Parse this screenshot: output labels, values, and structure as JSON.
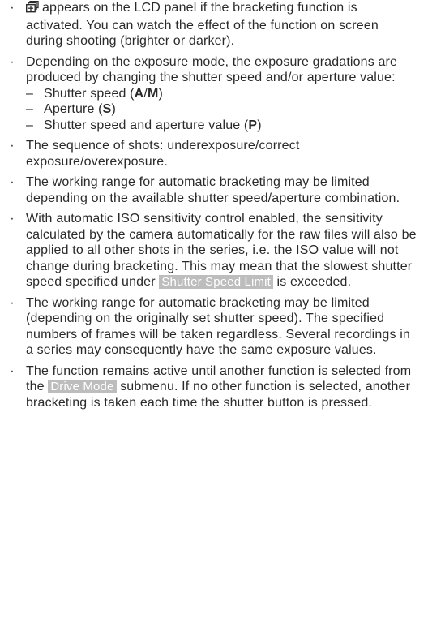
{
  "bullets": [
    {
      "icon": "bracketing-icon",
      "text": "appears on the LCD panel if the bracketing function is activated. You can watch the effect of the function on screen during shooting (brighter or darker)."
    },
    {
      "text": "Depending on the exposure mode, the exposure gradations are produced by changing the shutter speed and/or aperture value:",
      "sub": [
        {
          "pre": "Shutter speed (",
          "b1": "A",
          "mid": "/",
          "b2": "M",
          "post": ")"
        },
        {
          "pre": "Aperture (",
          "b1": "S",
          "post": ")"
        },
        {
          "pre": "Shutter speed and aperture value (",
          "b1": "P",
          "post": ")"
        }
      ]
    },
    {
      "text": "The sequence of shots: underexposure/correct exposure/overexposure."
    },
    {
      "text": "The working range for automatic bracketing may be limited depending on the available shutter speed/aperture combination."
    },
    {
      "pre": "With automatic ISO sensitivity control enabled, the sensitivity calculated by the camera automatically for the raw files will also be applied to all other shots in the series, i.e. the ISO value will not change during bracketing. This may mean that the slowest shutter speed specified under",
      "menu": "Shutter Speed Limit",
      "post": "is exceeded."
    },
    {
      "text": "The working range for automatic bracketing may be limited (depending on the originally set shutter speed). The specified numbers of frames will be taken regardless. Several recordings in a series may consequently have the same exposure values."
    },
    {
      "pre": "The function remains active until another function is selected from the",
      "menu": "Drive Mode",
      "post": "submenu. If no other function is selected, another bracketing is taken each time the shutter button is pressed."
    }
  ],
  "bullet_char": "·",
  "dash_char": "–"
}
